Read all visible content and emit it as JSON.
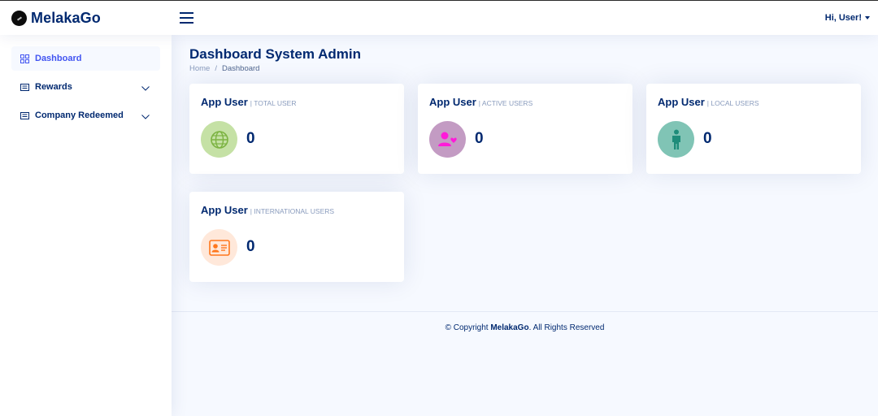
{
  "app": {
    "logo_text": "MelakaGo",
    "user_greeting": "Hi, User!"
  },
  "sidebar": {
    "items": [
      {
        "label": "Dashboard",
        "icon": "grid-icon",
        "active": true
      },
      {
        "label": "Rewards",
        "icon": "menu-button-icon",
        "expandable": true
      },
      {
        "label": "Company Redeemed",
        "icon": "menu-button-icon",
        "expandable": true
      }
    ]
  },
  "page": {
    "title": "Dashboard System Admin",
    "breadcrumb": [
      "Home",
      "Dashboard"
    ]
  },
  "cards": [
    {
      "title": "App User",
      "subtitle": "| TOTAL USER",
      "value": "0",
      "icon": "globe-icon",
      "icon_color": "#7cb342",
      "icon_bg": "#c5e1a5"
    },
    {
      "title": "App User",
      "subtitle": "| ACTIVE USERS",
      "value": "0",
      "icon": "users-heart-icon",
      "icon_color": "#ff1ad9",
      "icon_bg": "#c39bc3"
    },
    {
      "title": "App User",
      "subtitle": "| LOCAL USERS",
      "value": "0",
      "icon": "person-icon",
      "icon_color": "#1e8c7a",
      "icon_bg": "#80c4b5"
    },
    {
      "title": "App User",
      "subtitle": "| INTERNATIONAL USERS",
      "value": "0",
      "icon": "id-card-icon",
      "icon_color": "#ff771d",
      "icon_bg": "#ffe8da"
    }
  ],
  "footer": {
    "prefix": "© Copyright",
    "brand": "MelakaGo",
    "suffix": ". All Rights Reserved"
  }
}
